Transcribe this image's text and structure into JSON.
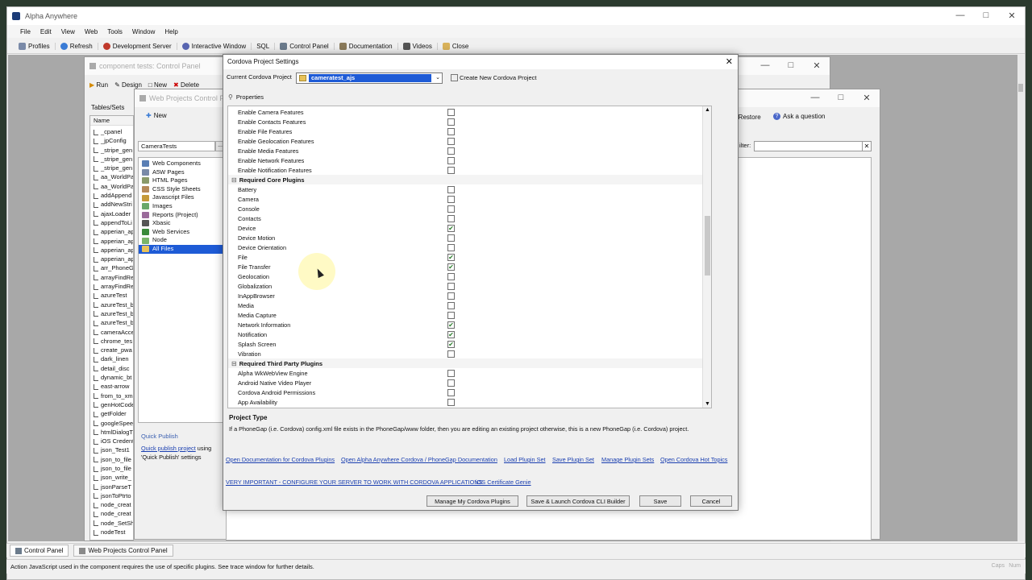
{
  "app": {
    "title": "Alpha Anywhere",
    "menu": [
      "File",
      "Edit",
      "View",
      "Web",
      "Tools",
      "Window",
      "Help"
    ],
    "toolbar": [
      "Profiles",
      "Refresh",
      "Development Server",
      "Interactive Window",
      "SQL",
      "Control Panel",
      "Documentation",
      "Videos",
      "Close"
    ]
  },
  "control_panel": {
    "title": "component tests: Control Panel",
    "actions": [
      "Run",
      "Design",
      "New",
      "Delete"
    ],
    "tab": "Tables/Sets",
    "column_header": "Name",
    "items": [
      "_cpanel",
      "_jpConfig",
      "_stripe_gen",
      "_stripe_gen",
      "_stripe_gen",
      "aa_WorldPa",
      "aa_WorldPa",
      "addAppend",
      "addNewStri",
      "ajaxLoader",
      "appendToLi",
      "apperian_ap",
      "apperian_ap",
      "apperian_ap",
      "apperian_ap",
      "arr_PhoneG",
      "arrayFindRe",
      "arrayFindRe",
      "azureTest",
      "azureTest_b",
      "azureTest_b",
      "azureTest_b",
      "cameraAcce",
      "chrome_tes",
      "create_pwa",
      "dark_linen",
      "detail_disc",
      "dynamic_bt",
      "east-arrow",
      "from_to_xm",
      "genHotCode",
      "getFolder",
      "googleSpeed",
      "htmlDialogT",
      "iOS Credent",
      "json_Test1",
      "json_to_file",
      "json_to_file",
      "json_write_",
      "jsonParseT",
      "jsonToPtrto",
      "node_creat",
      "node_creat",
      "node_SetSh",
      "nodeTest"
    ]
  },
  "web_projects": {
    "title": "Web Projects Control Panel",
    "new_label": "New",
    "project": "CameraTests",
    "tree": [
      "Web Components",
      "A5W Pages",
      "HTML Pages",
      "CSS Style Sheets",
      "Javascript Files",
      "Images",
      "Reports (Project)",
      "Xbasic",
      "Web Services",
      "Node",
      "All Files"
    ],
    "quick_publish_header": "Quick Publish",
    "quick_publish_link": "Quick publish project",
    "quick_publish_text1": "using",
    "quick_publish_text2": "'Quick Publish' settings",
    "help_items": [
      "p/Restore",
      "Ask a question"
    ],
    "filter_label": "ilter:"
  },
  "dialog": {
    "title": "Cordova Project Settings",
    "project_label": "Current Cordova Project",
    "project_value": "cameratest_ajs",
    "create_new": "Create New Cordova Project",
    "properties_label": "Properties",
    "rows": [
      {
        "type": "item",
        "name": "Enable Camera Features",
        "checked": false
      },
      {
        "type": "item",
        "name": "Enable Contacts Features",
        "checked": false
      },
      {
        "type": "item",
        "name": "Enable File Features",
        "checked": false
      },
      {
        "type": "item",
        "name": "Enable Geolocation Features",
        "checked": false
      },
      {
        "type": "item",
        "name": "Enable Media Features",
        "checked": false
      },
      {
        "type": "item",
        "name": "Enable Network Features",
        "checked": false
      },
      {
        "type": "item",
        "name": "Enable Notification Features",
        "checked": false
      },
      {
        "type": "cat",
        "name": "Required Core Plugins"
      },
      {
        "type": "item",
        "name": "Battery",
        "checked": false
      },
      {
        "type": "item",
        "name": "Camera",
        "checked": false
      },
      {
        "type": "item",
        "name": "Console",
        "checked": false
      },
      {
        "type": "item",
        "name": "Contacts",
        "checked": false
      },
      {
        "type": "item",
        "name": "Device",
        "checked": true
      },
      {
        "type": "item",
        "name": "Device Motion",
        "checked": false
      },
      {
        "type": "item",
        "name": "Device Orientation",
        "checked": false
      },
      {
        "type": "item",
        "name": "File",
        "checked": true
      },
      {
        "type": "item",
        "name": "File Transfer",
        "checked": true
      },
      {
        "type": "item",
        "name": "Geolocation",
        "checked": false
      },
      {
        "type": "item",
        "name": "Globalization",
        "checked": false
      },
      {
        "type": "item",
        "name": "InAppBrowser",
        "checked": false
      },
      {
        "type": "item",
        "name": "Media",
        "checked": false
      },
      {
        "type": "item",
        "name": "Media Capture",
        "checked": false
      },
      {
        "type": "item",
        "name": "Network Information",
        "checked": true
      },
      {
        "type": "item",
        "name": "Notification",
        "checked": true
      },
      {
        "type": "item",
        "name": "Splash Screen",
        "checked": true
      },
      {
        "type": "item",
        "name": "Vibration",
        "checked": false
      },
      {
        "type": "cat",
        "name": "Required Third Party Plugins"
      },
      {
        "type": "item",
        "name": "Alpha WkWebView Engine",
        "checked": false
      },
      {
        "type": "item",
        "name": "Android Native Video Player",
        "checked": false
      },
      {
        "type": "item",
        "name": "Cordova Android Permissions",
        "checked": false
      },
      {
        "type": "item",
        "name": "App Availability",
        "checked": false
      }
    ],
    "desc_title": "Project Type",
    "desc_text": "If a PhoneGap (i.e. Cordova) config.xml file exists in the PhoneGap/www folder, then you are editing an existing project otherwise, this is a new PhoneGap (i.e. Cordova) project.",
    "links_row1": [
      "Open Documentation for Cordova Plugins",
      "Open Alpha Anywhere Cordova / PhoneGap Documentation",
      "Load Plugin Set",
      "Save Plugin Set",
      "Manage Plugin Sets",
      "Open Cordova Hot Topics"
    ],
    "links_row2": [
      "VERY IMPORTANT - CONFIGURE YOUR SERVER TO WORK WITH CORDOVA APPLICATIONS",
      "iOS Certificate Genie"
    ],
    "buttons": {
      "manage": "Manage My Cordova Plugins",
      "save_launch": "Save & Launch Cordova CLI Builder",
      "save": "Save",
      "cancel": "Cancel"
    }
  },
  "taskbar": {
    "tabs": [
      "Control Panel",
      "Web Projects Control Panel"
    ]
  },
  "status": {
    "text": "Action JavaScript used in the component requires the use of specific plugins. See trace window for further details.",
    "indicators": [
      "Caps",
      "Num"
    ]
  }
}
